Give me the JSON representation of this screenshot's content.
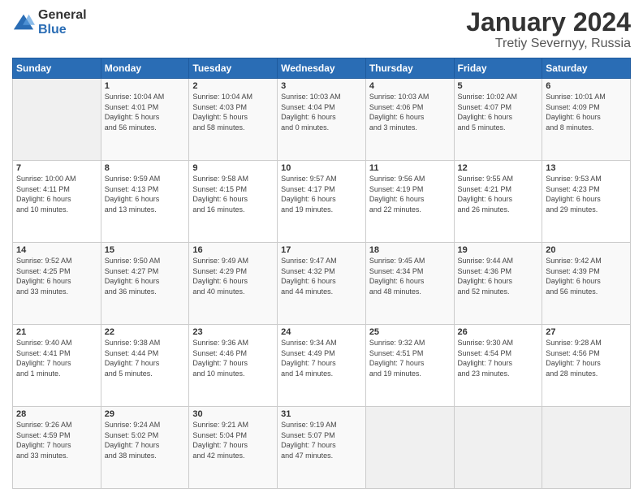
{
  "logo": {
    "general": "General",
    "blue": "Blue"
  },
  "title": "January 2024",
  "subtitle": "Tretiy Severnyy, Russia",
  "headers": [
    "Sunday",
    "Monday",
    "Tuesday",
    "Wednesday",
    "Thursday",
    "Friday",
    "Saturday"
  ],
  "weeks": [
    [
      {
        "day": "",
        "info": ""
      },
      {
        "day": "1",
        "info": "Sunrise: 10:04 AM\nSunset: 4:01 PM\nDaylight: 5 hours\nand 56 minutes."
      },
      {
        "day": "2",
        "info": "Sunrise: 10:04 AM\nSunset: 4:03 PM\nDaylight: 5 hours\nand 58 minutes."
      },
      {
        "day": "3",
        "info": "Sunrise: 10:03 AM\nSunset: 4:04 PM\nDaylight: 6 hours\nand 0 minutes."
      },
      {
        "day": "4",
        "info": "Sunrise: 10:03 AM\nSunset: 4:06 PM\nDaylight: 6 hours\nand 3 minutes."
      },
      {
        "day": "5",
        "info": "Sunrise: 10:02 AM\nSunset: 4:07 PM\nDaylight: 6 hours\nand 5 minutes."
      },
      {
        "day": "6",
        "info": "Sunrise: 10:01 AM\nSunset: 4:09 PM\nDaylight: 6 hours\nand 8 minutes."
      }
    ],
    [
      {
        "day": "7",
        "info": "Sunrise: 10:00 AM\nSunset: 4:11 PM\nDaylight: 6 hours\nand 10 minutes."
      },
      {
        "day": "8",
        "info": "Sunrise: 9:59 AM\nSunset: 4:13 PM\nDaylight: 6 hours\nand 13 minutes."
      },
      {
        "day": "9",
        "info": "Sunrise: 9:58 AM\nSunset: 4:15 PM\nDaylight: 6 hours\nand 16 minutes."
      },
      {
        "day": "10",
        "info": "Sunrise: 9:57 AM\nSunset: 4:17 PM\nDaylight: 6 hours\nand 19 minutes."
      },
      {
        "day": "11",
        "info": "Sunrise: 9:56 AM\nSunset: 4:19 PM\nDaylight: 6 hours\nand 22 minutes."
      },
      {
        "day": "12",
        "info": "Sunrise: 9:55 AM\nSunset: 4:21 PM\nDaylight: 6 hours\nand 26 minutes."
      },
      {
        "day": "13",
        "info": "Sunrise: 9:53 AM\nSunset: 4:23 PM\nDaylight: 6 hours\nand 29 minutes."
      }
    ],
    [
      {
        "day": "14",
        "info": "Sunrise: 9:52 AM\nSunset: 4:25 PM\nDaylight: 6 hours\nand 33 minutes."
      },
      {
        "day": "15",
        "info": "Sunrise: 9:50 AM\nSunset: 4:27 PM\nDaylight: 6 hours\nand 36 minutes."
      },
      {
        "day": "16",
        "info": "Sunrise: 9:49 AM\nSunset: 4:29 PM\nDaylight: 6 hours\nand 40 minutes."
      },
      {
        "day": "17",
        "info": "Sunrise: 9:47 AM\nSunset: 4:32 PM\nDaylight: 6 hours\nand 44 minutes."
      },
      {
        "day": "18",
        "info": "Sunrise: 9:45 AM\nSunset: 4:34 PM\nDaylight: 6 hours\nand 48 minutes."
      },
      {
        "day": "19",
        "info": "Sunrise: 9:44 AM\nSunset: 4:36 PM\nDaylight: 6 hours\nand 52 minutes."
      },
      {
        "day": "20",
        "info": "Sunrise: 9:42 AM\nSunset: 4:39 PM\nDaylight: 6 hours\nand 56 minutes."
      }
    ],
    [
      {
        "day": "21",
        "info": "Sunrise: 9:40 AM\nSunset: 4:41 PM\nDaylight: 7 hours\nand 1 minute."
      },
      {
        "day": "22",
        "info": "Sunrise: 9:38 AM\nSunset: 4:44 PM\nDaylight: 7 hours\nand 5 minutes."
      },
      {
        "day": "23",
        "info": "Sunrise: 9:36 AM\nSunset: 4:46 PM\nDaylight: 7 hours\nand 10 minutes."
      },
      {
        "day": "24",
        "info": "Sunrise: 9:34 AM\nSunset: 4:49 PM\nDaylight: 7 hours\nand 14 minutes."
      },
      {
        "day": "25",
        "info": "Sunrise: 9:32 AM\nSunset: 4:51 PM\nDaylight: 7 hours\nand 19 minutes."
      },
      {
        "day": "26",
        "info": "Sunrise: 9:30 AM\nSunset: 4:54 PM\nDaylight: 7 hours\nand 23 minutes."
      },
      {
        "day": "27",
        "info": "Sunrise: 9:28 AM\nSunset: 4:56 PM\nDaylight: 7 hours\nand 28 minutes."
      }
    ],
    [
      {
        "day": "28",
        "info": "Sunrise: 9:26 AM\nSunset: 4:59 PM\nDaylight: 7 hours\nand 33 minutes."
      },
      {
        "day": "29",
        "info": "Sunrise: 9:24 AM\nSunset: 5:02 PM\nDaylight: 7 hours\nand 38 minutes."
      },
      {
        "day": "30",
        "info": "Sunrise: 9:21 AM\nSunset: 5:04 PM\nDaylight: 7 hours\nand 42 minutes."
      },
      {
        "day": "31",
        "info": "Sunrise: 9:19 AM\nSunset: 5:07 PM\nDaylight: 7 hours\nand 47 minutes."
      },
      {
        "day": "",
        "info": ""
      },
      {
        "day": "",
        "info": ""
      },
      {
        "day": "",
        "info": ""
      }
    ]
  ]
}
